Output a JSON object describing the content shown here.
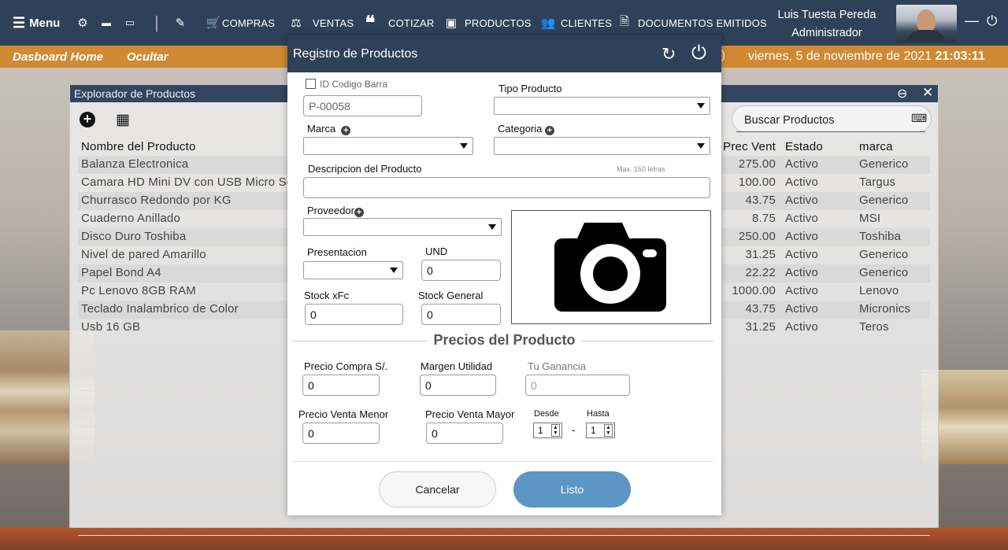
{
  "topbar": {
    "menu_label": "Menu",
    "items": [
      {
        "label": "COMPRAS",
        "icon": "cart-icon"
      },
      {
        "label": "VENTAS",
        "icon": "cashier-icon"
      },
      {
        "label": "COTIZAR",
        "icon": "quote-icon"
      },
      {
        "label": "PRODUCTOS",
        "icon": "boxes-icon"
      },
      {
        "label": "CLIENTES",
        "icon": "people-icon"
      },
      {
        "label": "DOCUMENTOS EMITIDOS",
        "icon": "documents-icon"
      }
    ],
    "user_name": "Luis Tuesta Pereda",
    "user_role": "Administrador"
  },
  "subbar": {
    "home_label": "Dasboard Home",
    "hide_label": "Ocultar",
    "date": "viernes, 5 de noviembre de 2021",
    "time": "21:03:11"
  },
  "explorer": {
    "title": "Explorador de Productos",
    "search_label": "Buscar Productos",
    "headers": {
      "name": "Nombre del Producto",
      "price": "Prec Vent",
      "state": "Estado",
      "brand": "marca"
    },
    "rows": [
      {
        "name": "Balanza Electronica",
        "price": "275.00",
        "state": "Activo",
        "brand": "Generico"
      },
      {
        "name": "Camara HD Mini DV con USB Micro Sd",
        "price": "100.00",
        "state": "Activo",
        "brand": "Targus"
      },
      {
        "name": "Churrasco Redondo por KG",
        "price": "43.75",
        "state": "Activo",
        "brand": "Generico"
      },
      {
        "name": "Cuaderno Anillado",
        "price": "8.75",
        "state": "Activo",
        "brand": "MSI"
      },
      {
        "name": "Disco Duro Toshiba",
        "price": "250.00",
        "state": "Activo",
        "brand": "Toshiba"
      },
      {
        "name": "Nivel de pared Amarillo",
        "price": "31.25",
        "state": "Activo",
        "brand": "Generico"
      },
      {
        "name": "Papel Bond A4",
        "price": "22.22",
        "state": "Activo",
        "brand": "Generico"
      },
      {
        "name": "Pc Lenovo 8GB RAM",
        "price": "1000.00",
        "state": "Activo",
        "brand": "Lenovo"
      },
      {
        "name": "Teclado Inalambrico de Color",
        "price": "43.75",
        "state": "Activo",
        "brand": "Micronics"
      },
      {
        "name": "Usb 16 GB",
        "price": "31.25",
        "state": "Activo",
        "brand": "Teros"
      }
    ]
  },
  "modal": {
    "title": "Registro de Productos",
    "id_barcode_label": "ID Codigo Barra",
    "code_value": "P-00058",
    "tipo_label": "Tipo Producto",
    "marca_label": "Marca",
    "categoria_label": "Categoria",
    "desc_label": "Descripcion del Producto",
    "desc_hint": "Max. 150 letras",
    "proveedor_label": "Proveedor",
    "presentacion_label": "Presentacion",
    "und_label": "UND",
    "und_value": "0",
    "stock_fc_label": "Stock xFc",
    "stock_fc_value": "0",
    "stock_gen_label": "Stock General",
    "stock_gen_value": "0",
    "prices_title": "Precios del Producto",
    "compra_label": "Precio Compra S/.",
    "compra_value": "0",
    "margen_label": "Margen Utilidad",
    "margen_value": "0",
    "ganancia_label": "Tu Ganancia",
    "ganancia_value": "0",
    "menor_label": "Precio Venta Menor",
    "menor_value": "0",
    "mayor_label": "Precio Venta Mayor",
    "mayor_value": "0",
    "desde_label": "Desde",
    "desde_value": "1",
    "hasta_label": "Hasta",
    "hasta_value": "1",
    "range_sep": "-",
    "cancel_label": "Cancelar",
    "ok_label": "Listo"
  }
}
